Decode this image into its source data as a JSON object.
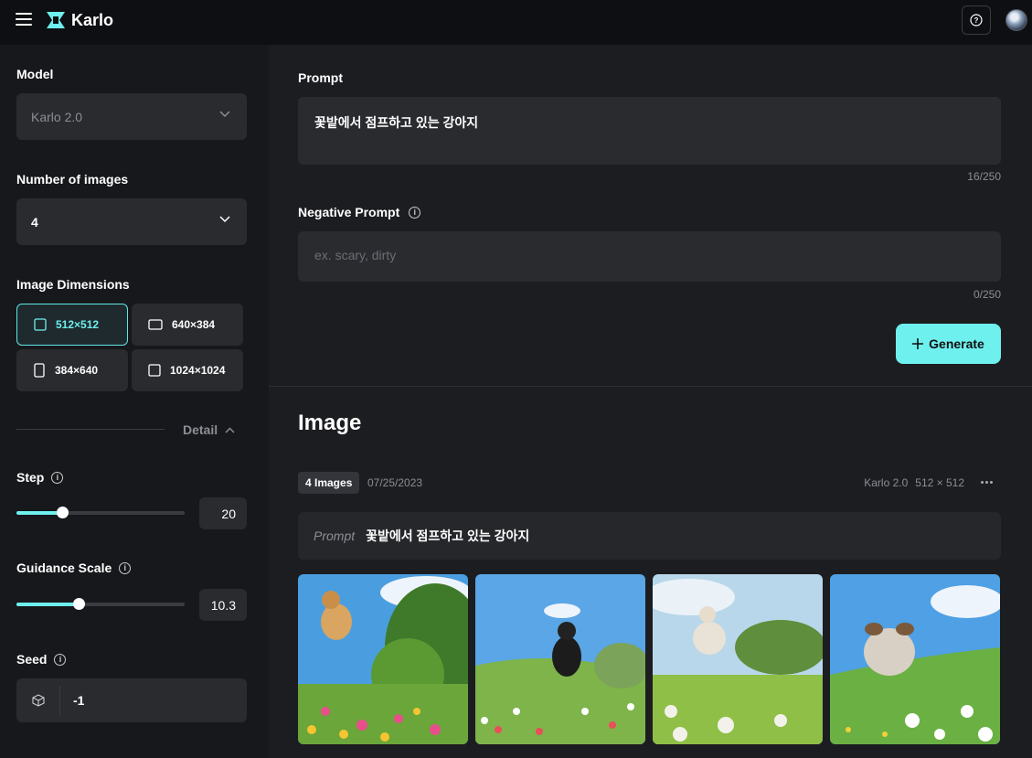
{
  "app": {
    "title": "Karlo"
  },
  "colors": {
    "accent": "#6ef0ee",
    "bg": "#1c1d20",
    "sidebar": "#17181b"
  },
  "sidebar": {
    "model": {
      "label": "Model",
      "value": "Karlo 2.0"
    },
    "num_images": {
      "label": "Number of images",
      "value": "4"
    },
    "dimensions": {
      "label": "Image Dimensions",
      "options": [
        "512×512",
        "640×384",
        "384×640",
        "1024×1024"
      ],
      "selected": "512×512"
    },
    "detail_label": "Detail",
    "step": {
      "label": "Step",
      "value": "20",
      "fill_fraction": 0.27
    },
    "guidance": {
      "label": "Guidance Scale",
      "value": "10.3",
      "fill_fraction": 0.37
    },
    "seed": {
      "label": "Seed",
      "value": "-1"
    }
  },
  "main": {
    "prompt": {
      "label": "Prompt",
      "value": "꽃밭에서 점프하고 있는 강아지",
      "counter": "16/250"
    },
    "negative_prompt": {
      "label": "Negative Prompt",
      "placeholder": "ex. scary, dirty",
      "counter": "0/250"
    },
    "generate_label": "Generate",
    "image_section": {
      "title": "Image",
      "badge": "4 Images",
      "date": "07/25/2023",
      "model": "Karlo 2.0",
      "size": "512 × 512",
      "prompt_label": "Prompt",
      "prompt_value": "꽃밭에서 점프하고 있는 강아지"
    }
  }
}
